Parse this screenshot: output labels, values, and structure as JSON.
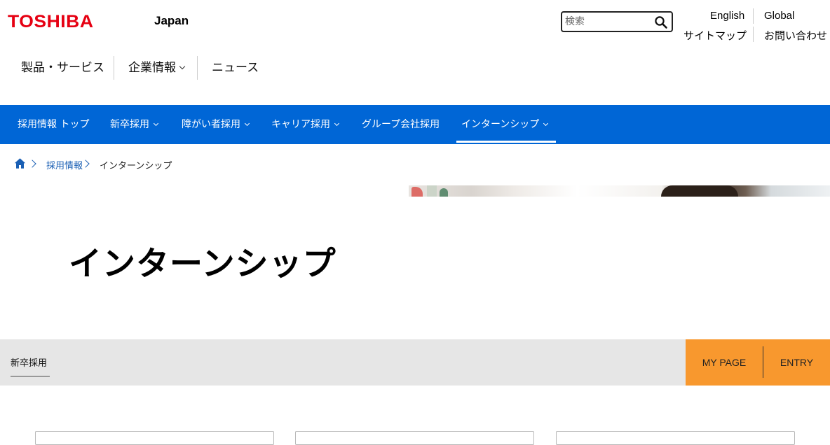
{
  "header": {
    "logo_text": "TOSHIBA",
    "region": "Japan",
    "search": {
      "placeholder": "検索"
    },
    "utility_links": [
      "English",
      "Global",
      "サイトマップ",
      "お問い合わせ"
    ]
  },
  "main_nav": {
    "items": [
      "製品・サービス",
      "企業情報",
      "ニュース"
    ]
  },
  "recruit_nav": {
    "items": [
      "採用情報 トップ",
      "新卒採用",
      "障がい者採用",
      "キャリア採用",
      "グループ会社採用",
      "インターンシップ"
    ],
    "active_item": "インターンシップ"
  },
  "breadcrumb": {
    "items": [
      "採用情報",
      "インターンシップ"
    ]
  },
  "hero": {
    "title": "インターンシップ"
  },
  "sub_bar": {
    "tab": "新卒採用",
    "buttons": [
      "MY PAGE",
      "ENTRY"
    ]
  },
  "colors": {
    "brand_red": "#e60012",
    "nav_blue": "#0066d6",
    "link_blue": "#1a5fb4",
    "accent_orange": "#f8982e",
    "sub_bar_grey": "#e6e6e6"
  },
  "icons": [
    "search-icon",
    "home-icon",
    "chevron-down-icon",
    "chevron-right-icon"
  ]
}
